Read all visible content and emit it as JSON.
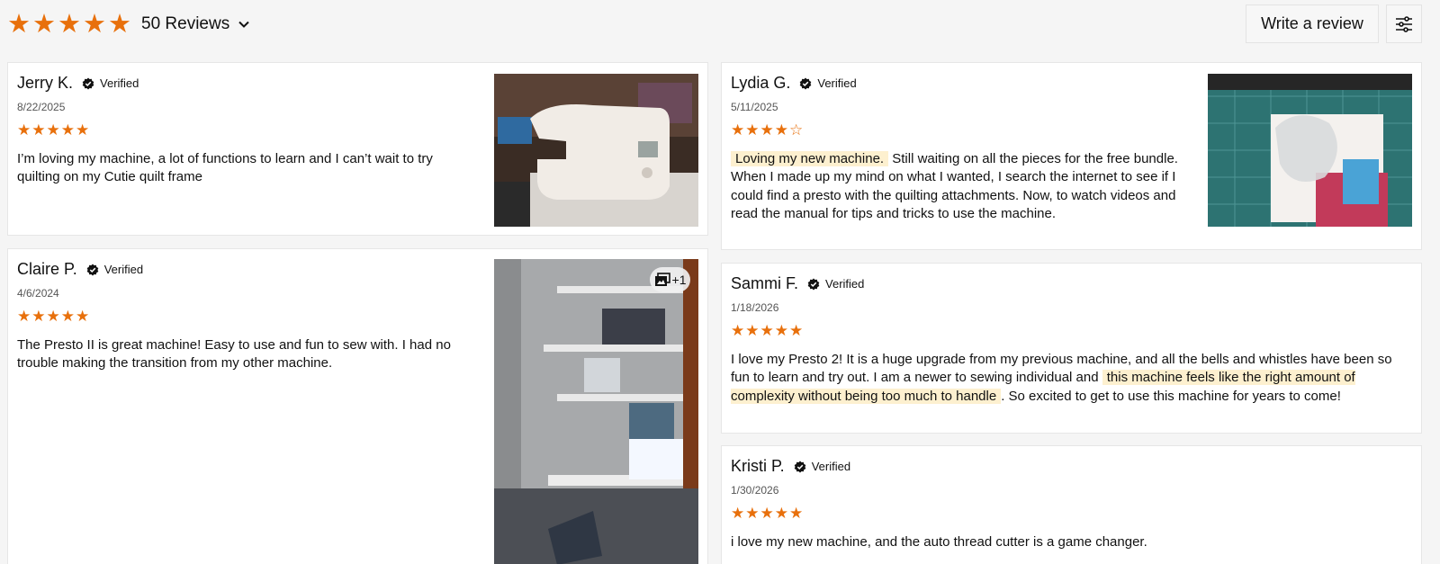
{
  "summary": {
    "stars": [
      "★",
      "★",
      "★",
      "★",
      "★"
    ],
    "review_count": "50 Reviews",
    "chevron_icon": "chevron-down-icon"
  },
  "actions": {
    "write_review": "Write a review",
    "filter_icon": "sliders-icon"
  },
  "accent_color": "#e8700c",
  "highlight_color": "#fdf0cf",
  "reviews": [
    {
      "name": "Jerry K.",
      "verified": "Verified",
      "date": "8/22/2025",
      "stars": [
        "★",
        "★",
        "★",
        "★",
        "★"
      ],
      "rating": 5,
      "text": "I’m loving my machine, a lot of functions to learn and I can’t wait to try quilting on my Cutie quilt frame"
    },
    {
      "name": "Claire P.",
      "verified": "Verified",
      "date": "4/6/2024",
      "stars": [
        "★",
        "★",
        "★",
        "★",
        "★"
      ],
      "rating": 5,
      "text": "The Presto II is  great machine! Easy to use and fun to sew with. I had no trouble making the transition from my other machine.",
      "more_photos": "+1"
    },
    {
      "name": "Lydia G.",
      "verified": "Verified",
      "date": "5/11/2025",
      "stars": [
        "★",
        "★",
        "★",
        "★",
        "☆"
      ],
      "rating": 4,
      "highlight": "Loving my new machine.",
      "text": " Still waiting on all the pieces for the free bundle.  When I made up my mind on what I wanted, I search the internet to see if I could find a presto with the quilting attachments. Now, to watch videos and read the manual for tips and tricks to use the machine."
    },
    {
      "name": "Sammi F.",
      "verified": "Verified",
      "date": "1/18/2026",
      "stars": [
        "★",
        "★",
        "★",
        "★",
        "★"
      ],
      "rating": 5,
      "text_before": " I love my Presto 2! It is a huge upgrade from my previous machine, and all the bells and whistles have been so fun to learn and try out. I am a newer to sewing individual and ",
      "highlight": "this machine feels like the right amount of complexity without being too much to handle",
      "text_after": ". So excited to get to use this machine for years to come!"
    },
    {
      "name": "Kristi P.",
      "verified": "Verified",
      "date": "1/30/2026",
      "stars": [
        "★",
        "★",
        "★",
        "★",
        "★"
      ],
      "rating": 5,
      "text": "i love my new machine, and the auto thread cutter is a game changer."
    }
  ]
}
